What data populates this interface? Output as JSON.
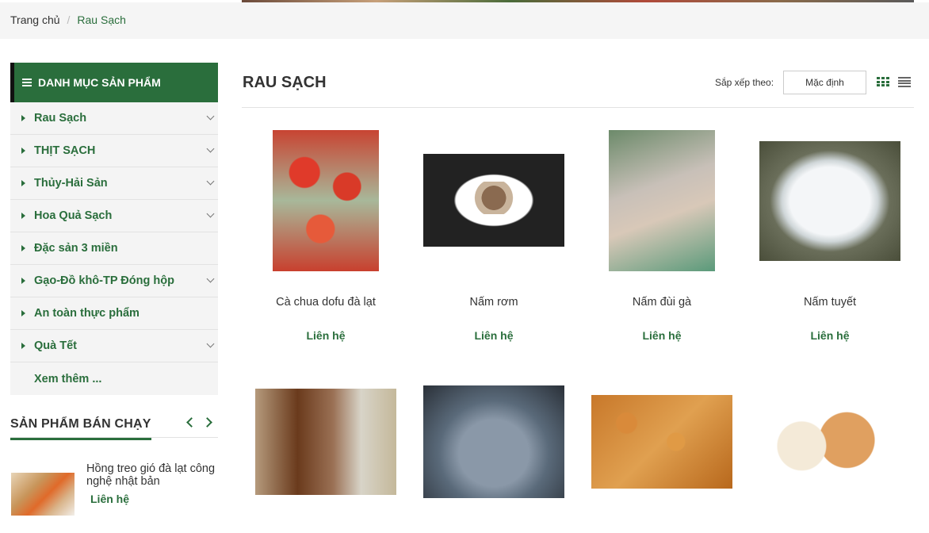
{
  "breadcrumb": {
    "home": "Trang chủ",
    "separator": "/",
    "current": "Rau Sạch"
  },
  "sidebar": {
    "heading": "DANH MỤC SẢN PHẨM",
    "items": [
      {
        "label": "Rau Sạch",
        "expandable": true
      },
      {
        "label": "THỊT SẠCH",
        "expandable": true
      },
      {
        "label": "Thủy-Hải Sản",
        "expandable": true
      },
      {
        "label": "Hoa Quả Sạch",
        "expandable": true
      },
      {
        "label": "Đặc sản 3 miền",
        "expandable": false
      },
      {
        "label": "Gạo-Đồ khô-TP Đóng hộp",
        "expandable": true
      },
      {
        "label": "An toàn thực phẩm",
        "expandable": false
      },
      {
        "label": "Quà Tết",
        "expandable": true
      }
    ],
    "more": "Xem thêm ..."
  },
  "bestsellers": {
    "heading": "SẢN PHẨM BÁN CHẠY",
    "items": [
      {
        "name": "Hồng treo gió đà lạt công nghệ nhật bản",
        "price": "Liên hệ"
      }
    ]
  },
  "main": {
    "title": "RAU SẠCH",
    "sort_label": "Sắp xếp theo:",
    "sort_value": "Mặc định",
    "products": [
      {
        "name": "Cà chua dofu đà lạt",
        "price": "Liên hệ"
      },
      {
        "name": "Nấm rơm",
        "price": "Liên hệ"
      },
      {
        "name": "Nấm đùi gà",
        "price": "Liên hệ"
      },
      {
        "name": "Nấm tuyết",
        "price": "Liên hệ"
      },
      {
        "name": "",
        "price": ""
      },
      {
        "name": "",
        "price": ""
      },
      {
        "name": "",
        "price": ""
      },
      {
        "name": "",
        "price": ""
      }
    ]
  },
  "colors": {
    "brand_green": "#2a6e3c",
    "sidebar_bg": "#f4f4f4"
  },
  "icons": [
    "menu-icon",
    "chevron-down-icon",
    "caret-right-icon",
    "chevron-left-icon",
    "chevron-right-icon",
    "grid-view-icon",
    "list-view-icon"
  ]
}
